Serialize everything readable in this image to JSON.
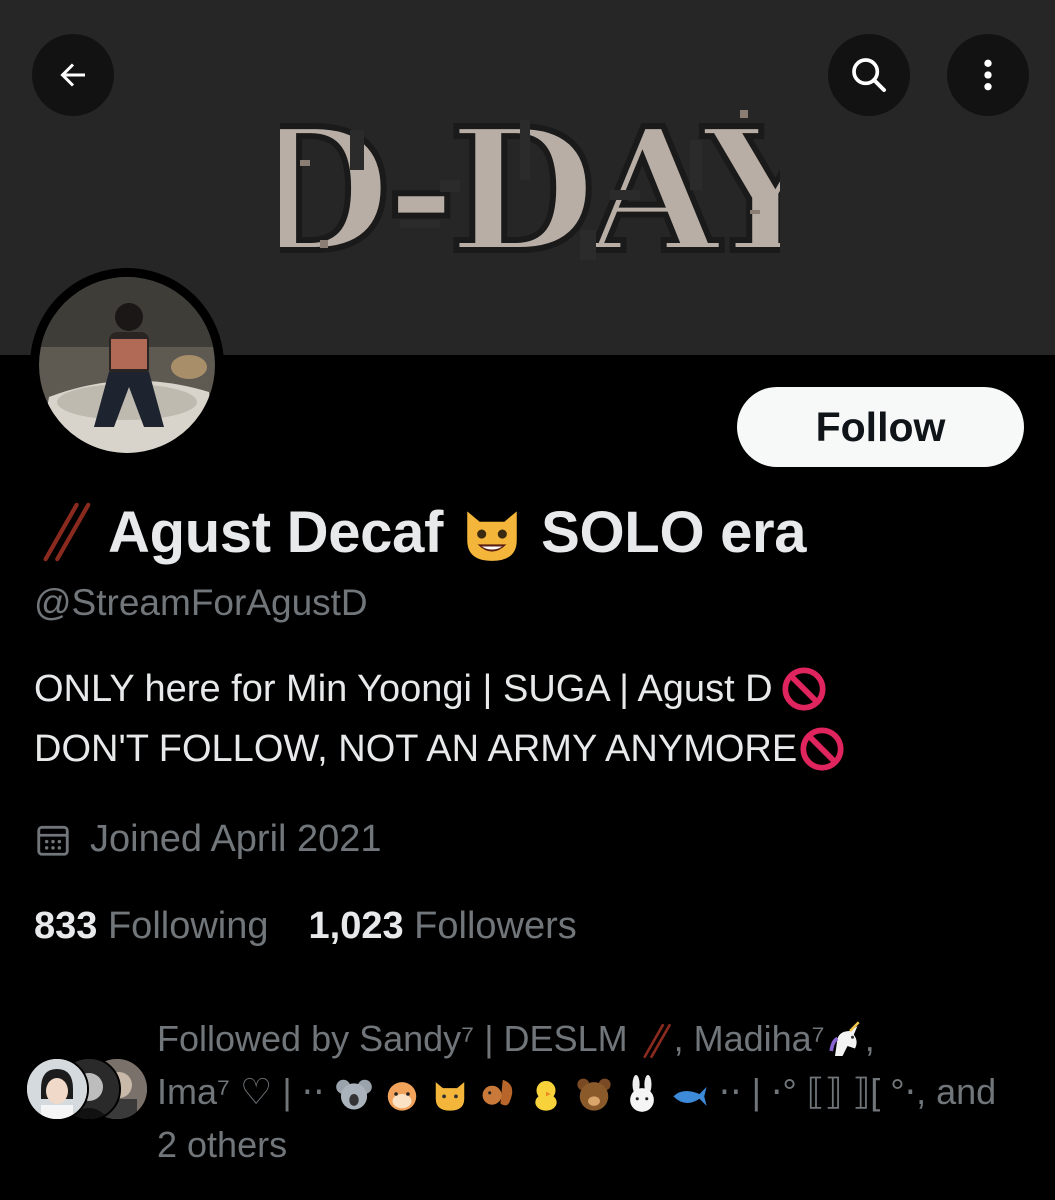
{
  "header": {
    "back_icon": "arrow-left-icon",
    "search_icon": "search-icon",
    "more_icon": "more-vertical-icon",
    "banner_text": "D-DAY"
  },
  "profile": {
    "follow_label": "Follow",
    "display_name": "Agust Decaf",
    "display_name_suffix": "SOLO era",
    "handle": "@StreamForAgustD",
    "bio_line1": "ONLY here for Min Yoongi | SUGA | Agust D",
    "bio_line2": "DON'T FOLLOW, NOT AN ARMY ANYMORE",
    "joined": "Joined April 2021",
    "following_count": "833",
    "following_label": "Following",
    "followers_count": "1,023",
    "followers_label": "Followers"
  },
  "followed_by": {
    "prefix": "Followed by Sandy⁷ | DESLM",
    "name2": ", Madiha⁷",
    "name3": "Ima⁷ ♡ | ⋅⋅",
    "mid": "⋅⋅ | ⋅° ⟦⟧ ⟧[ °⋅, and",
    "others": "2 others"
  },
  "colors": {
    "background": "#000000",
    "banner": "#262626",
    "text_primary": "#e7e9ea",
    "text_secondary": "#71767b",
    "follow_button_bg": "#f7f9f9",
    "prohibited_red": "#e0245e"
  }
}
